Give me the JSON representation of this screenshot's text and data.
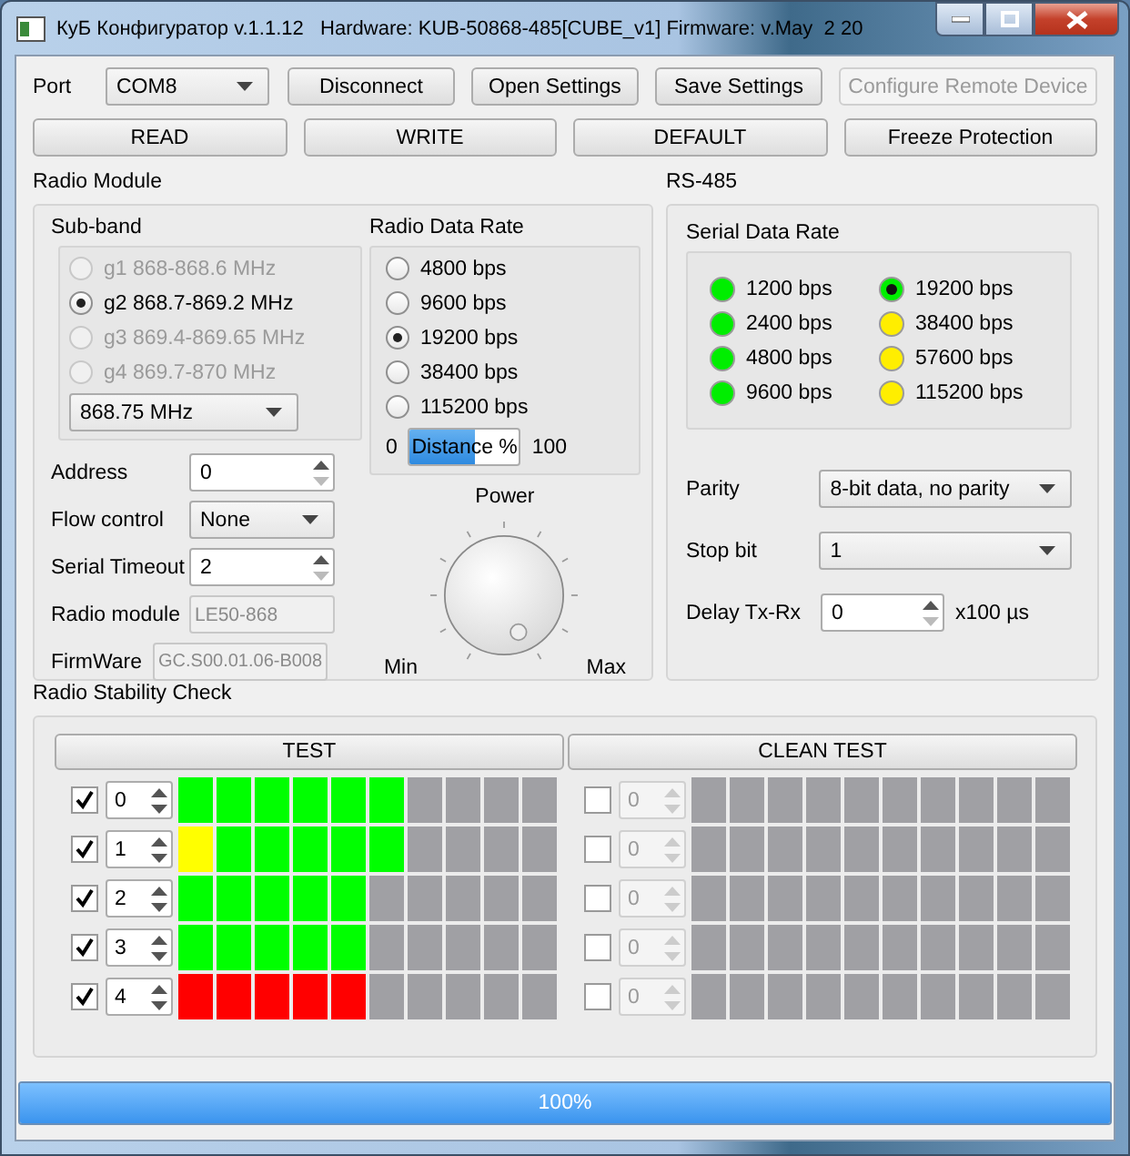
{
  "window": {
    "title": "КуБ Конфигуратор v.1.1.12   Hardware: KUB-50868-485[CUBE_v1] Firmware: v.May  2 20"
  },
  "toolbar": {
    "port_label": "Port",
    "port": "COM8",
    "buttons": [
      {
        "label": "Disconnect",
        "disabled": false
      },
      {
        "label": "Open Settings",
        "disabled": false
      },
      {
        "label": "Save Settings",
        "disabled": false
      },
      {
        "label": "Configure Remote Device",
        "disabled": true
      }
    ]
  },
  "actions": [
    "READ",
    "WRITE",
    "DEFAULT",
    "Freeze Protection"
  ],
  "radio_module": {
    "title": "Radio Module",
    "sub_band": {
      "title": "Sub-band",
      "options": [
        {
          "label": "g1 868-868.6 MHz",
          "selected": false,
          "disabled": true
        },
        {
          "label": "g2 868.7-869.2 MHz",
          "selected": true,
          "disabled": false
        },
        {
          "label": "g3 869.4-869.65 MHz",
          "selected": false,
          "disabled": true
        },
        {
          "label": "g4 869.7-870 MHz",
          "selected": false,
          "disabled": true
        }
      ],
      "channel": "868.75 MHz"
    },
    "fields": [
      {
        "kind": "spin",
        "label": "Address",
        "value": "0"
      },
      {
        "kind": "combo",
        "label": "Flow control",
        "value": "None"
      },
      {
        "kind": "spin",
        "label": "Serial Timeout",
        "value": "2"
      },
      {
        "kind": "readonly",
        "label": "Radio module",
        "value": "LE50-868"
      },
      {
        "kind": "readonly",
        "label": "FirmWare",
        "value": "GC.S00.01.06-B008"
      }
    ],
    "data_rate": {
      "title": "Radio Data Rate",
      "options": [
        {
          "label": "4800 bps",
          "selected": false
        },
        {
          "label": "9600 bps",
          "selected": false
        },
        {
          "label": "19200 bps",
          "selected": true
        },
        {
          "label": "38400 bps",
          "selected": false
        },
        {
          "label": "115200 bps",
          "selected": false
        }
      ],
      "distance": {
        "min": "0",
        "label": "Distance %",
        "level": 0.6,
        "max": "100"
      }
    },
    "power": {
      "title": "Power",
      "min": "Min",
      "max": "Max"
    }
  },
  "rs485": {
    "title": "RS-485",
    "serial_rate": {
      "title": "Serial Data Rate",
      "rates": [
        {
          "label": "1200 bps",
          "color": "#00ee00",
          "selected": false
        },
        {
          "label": "2400 bps",
          "color": "#00ee00",
          "selected": false
        },
        {
          "label": "4800 bps",
          "color": "#00ee00",
          "selected": false
        },
        {
          "label": "9600 bps",
          "color": "#00ee00",
          "selected": false
        },
        {
          "label": "19200 bps",
          "color": "#00ee00",
          "selected": true
        },
        {
          "label": "38400 bps",
          "color": "#ffee00",
          "selected": false
        },
        {
          "label": "57600 bps",
          "color": "#ffee00",
          "selected": false
        },
        {
          "label": "115200 bps",
          "color": "#ffee00",
          "selected": false
        }
      ]
    },
    "fields": [
      {
        "kind": "combo",
        "label": "Parity",
        "value": "8-bit data, no parity"
      },
      {
        "kind": "combo",
        "label": "Stop bit",
        "value": "1"
      },
      {
        "kind": "spin",
        "label": "Delay Tx-Rx",
        "value": "0",
        "unit": "x100 µs"
      }
    ]
  },
  "stability": {
    "title": "Radio Stability Check",
    "test_button": "TEST",
    "clean_button": "CLEAN TEST",
    "test_rows": [
      {
        "checked": true,
        "disabled": false,
        "value": "0",
        "cells": [
          {
            "color": "#00ff00"
          },
          {
            "color": "#00ff00"
          },
          {
            "color": "#00ff00"
          },
          {
            "color": "#00ff00"
          },
          {
            "color": "#00ff00"
          },
          {
            "color": "#00ff00"
          },
          {
            "color": "#a0a0a4"
          },
          {
            "color": "#a0a0a4"
          },
          {
            "color": "#a0a0a4"
          },
          {
            "color": "#a0a0a4"
          }
        ]
      },
      {
        "checked": true,
        "disabled": false,
        "value": "1",
        "cells": [
          {
            "color": "#ffff00"
          },
          {
            "color": "#00ff00"
          },
          {
            "color": "#00ff00"
          },
          {
            "color": "#00ff00"
          },
          {
            "color": "#00ff00"
          },
          {
            "color": "#00ff00"
          },
          {
            "color": "#a0a0a4"
          },
          {
            "color": "#a0a0a4"
          },
          {
            "color": "#a0a0a4"
          },
          {
            "color": "#a0a0a4"
          }
        ]
      },
      {
        "checked": true,
        "disabled": false,
        "value": "2",
        "cells": [
          {
            "color": "#00ff00"
          },
          {
            "color": "#00ff00"
          },
          {
            "color": "#00ff00"
          },
          {
            "color": "#00ff00"
          },
          {
            "color": "#00ff00"
          },
          {
            "color": "#a0a0a4"
          },
          {
            "color": "#a0a0a4"
          },
          {
            "color": "#a0a0a4"
          },
          {
            "color": "#a0a0a4"
          },
          {
            "color": "#a0a0a4"
          }
        ]
      },
      {
        "checked": true,
        "disabled": false,
        "value": "3",
        "cells": [
          {
            "color": "#00ff00"
          },
          {
            "color": "#00ff00"
          },
          {
            "color": "#00ff00"
          },
          {
            "color": "#00ff00"
          },
          {
            "color": "#00ff00"
          },
          {
            "color": "#a0a0a4"
          },
          {
            "color": "#a0a0a4"
          },
          {
            "color": "#a0a0a4"
          },
          {
            "color": "#a0a0a4"
          },
          {
            "color": "#a0a0a4"
          }
        ]
      },
      {
        "checked": true,
        "disabled": false,
        "value": "4",
        "cells": [
          {
            "color": "#ff0000"
          },
          {
            "color": "#ff0000"
          },
          {
            "color": "#ff0000"
          },
          {
            "color": "#ff0000"
          },
          {
            "color": "#ff0000"
          },
          {
            "color": "#a0a0a4"
          },
          {
            "color": "#a0a0a4"
          },
          {
            "color": "#a0a0a4"
          },
          {
            "color": "#a0a0a4"
          },
          {
            "color": "#a0a0a4"
          }
        ]
      }
    ],
    "clean_rows": [
      {
        "checked": false,
        "disabled": true,
        "value": "0",
        "cells": [
          {
            "color": "#a0a0a4"
          },
          {
            "color": "#a0a0a4"
          },
          {
            "color": "#a0a0a4"
          },
          {
            "color": "#a0a0a4"
          },
          {
            "color": "#a0a0a4"
          },
          {
            "color": "#a0a0a4"
          },
          {
            "color": "#a0a0a4"
          },
          {
            "color": "#a0a0a4"
          },
          {
            "color": "#a0a0a4"
          },
          {
            "color": "#a0a0a4"
          }
        ]
      },
      {
        "checked": false,
        "disabled": true,
        "value": "0",
        "cells": [
          {
            "color": "#a0a0a4"
          },
          {
            "color": "#a0a0a4"
          },
          {
            "color": "#a0a0a4"
          },
          {
            "color": "#a0a0a4"
          },
          {
            "color": "#a0a0a4"
          },
          {
            "color": "#a0a0a4"
          },
          {
            "color": "#a0a0a4"
          },
          {
            "color": "#a0a0a4"
          },
          {
            "color": "#a0a0a4"
          },
          {
            "color": "#a0a0a4"
          }
        ]
      },
      {
        "checked": false,
        "disabled": true,
        "value": "0",
        "cells": [
          {
            "color": "#a0a0a4"
          },
          {
            "color": "#a0a0a4"
          },
          {
            "color": "#a0a0a4"
          },
          {
            "color": "#a0a0a4"
          },
          {
            "color": "#a0a0a4"
          },
          {
            "color": "#a0a0a4"
          },
          {
            "color": "#a0a0a4"
          },
          {
            "color": "#a0a0a4"
          },
          {
            "color": "#a0a0a4"
          },
          {
            "color": "#a0a0a4"
          }
        ]
      },
      {
        "checked": false,
        "disabled": true,
        "value": "0",
        "cells": [
          {
            "color": "#a0a0a4"
          },
          {
            "color": "#a0a0a4"
          },
          {
            "color": "#a0a0a4"
          },
          {
            "color": "#a0a0a4"
          },
          {
            "color": "#a0a0a4"
          },
          {
            "color": "#a0a0a4"
          },
          {
            "color": "#a0a0a4"
          },
          {
            "color": "#a0a0a4"
          },
          {
            "color": "#a0a0a4"
          },
          {
            "color": "#a0a0a4"
          }
        ]
      },
      {
        "checked": false,
        "disabled": true,
        "value": "0",
        "cells": [
          {
            "color": "#a0a0a4"
          },
          {
            "color": "#a0a0a4"
          },
          {
            "color": "#a0a0a4"
          },
          {
            "color": "#a0a0a4"
          },
          {
            "color": "#a0a0a4"
          },
          {
            "color": "#a0a0a4"
          },
          {
            "color": "#a0a0a4"
          },
          {
            "color": "#a0a0a4"
          },
          {
            "color": "#a0a0a4"
          },
          {
            "color": "#a0a0a4"
          }
        ]
      }
    ]
  },
  "progress": {
    "level": 1,
    "text": "100%"
  }
}
